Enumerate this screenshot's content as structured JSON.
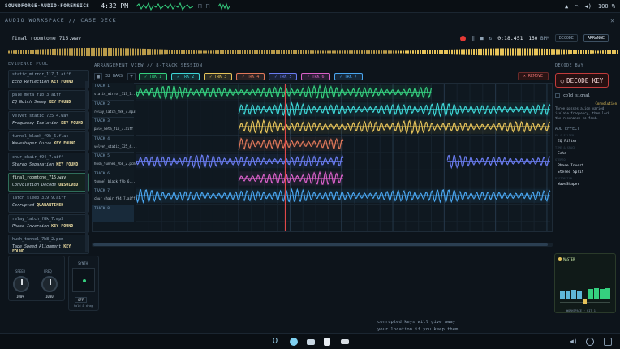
{
  "system": {
    "app_name": "SOUNDFORGE-AUDIO-FORENSICS",
    "clock": "4:32 PM",
    "battery": "100 %"
  },
  "window": {
    "title": "AUDIO WORKSPACE // CASE DECK",
    "close_label": "✕"
  },
  "file": {
    "name": "final_roomtone_715.wav"
  },
  "transport": {
    "time": "0:18.451",
    "bpm": "150",
    "bpm_unit": "BPM",
    "mode1": "DECODE",
    "mode2": "ARRANGE"
  },
  "evidence": {
    "title": "EVIDENCE POOL",
    "items": [
      {
        "name": "static_mirror_117_1.aiff",
        "status": "Echo Reflection",
        "key": "KEY FOUND"
      },
      {
        "name": "pale_meta_f1b_3.aiff",
        "status": "EQ Notch Sweep",
        "key": "KEY FOUND"
      },
      {
        "name": "velvet_static_725_4.wav",
        "status": "Frequency Isolation",
        "key": "KEY FOUND"
      },
      {
        "name": "tunnel_black_f9b_6.flac",
        "status": "Waveshaper Curve",
        "key": "KEY FOUND"
      },
      {
        "name": "chur_chair_f94_7.aiff",
        "status": "Stereo Separation",
        "key": "KEY FOUND"
      },
      {
        "name": "final_roomtone_715.wav",
        "status": "Convolution Decode",
        "key": "UNSOLVED"
      },
      {
        "name": "latch_sleep_319_9.aiff",
        "status": "Corrupted",
        "key": "QUARANTINED"
      },
      {
        "name": "relay_latch_f8k_7.mp3",
        "status": "Phase Inversion",
        "key": "KEY FOUND"
      },
      {
        "name": "hush_tunnel_7b8_2.pcm",
        "status": "Tape Speed Alignment",
        "key": "KEY FOUND"
      }
    ]
  },
  "arrangement": {
    "title": "ARRANGEMENT VIEW // 8-TRACK SESSION",
    "bars_label": "32 BARS",
    "remove_label": "✕ REMOVE",
    "tabs": [
      {
        "label": "✓ TRK 1",
        "color": "#35d07f"
      },
      {
        "label": "✓ TRK 2",
        "color": "#3ed6d6"
      },
      {
        "label": "✓ TRK 3",
        "color": "#e6c35a"
      },
      {
        "label": "✓ TRK 4",
        "color": "#e0785a"
      },
      {
        "label": "✓ TRK 5",
        "color": "#6a7cf0"
      },
      {
        "label": "✓ TRK 6",
        "color": "#d860c8"
      },
      {
        "label": "✓ TRK 7",
        "color": "#4aa6f0"
      }
    ],
    "tracks": [
      {
        "label": "TRACK 1",
        "file": "static_mirror_117_1...",
        "color": "#35d07f"
      },
      {
        "label": "TRACK 2",
        "file": "relay_latch_f8k_7.mp3",
        "color": "#3ed6d6"
      },
      {
        "label": "TRACK 3",
        "file": "pale_meta_f1b_3.aiff",
        "color": "#e6c35a"
      },
      {
        "label": "TRACK 4",
        "file": "velvet_static_725_4...",
        "color": "#e0785a"
      },
      {
        "label": "TRACK 5",
        "file": "hush_tunnel_7b8_2.pcm",
        "color": "#6a7cf0"
      },
      {
        "label": "TRACK 6",
        "file": "tunnel_black_f9b_6...",
        "color": "#d860c8"
      },
      {
        "label": "TRACK 7",
        "file": "chur_chair_f94_7.aiff",
        "color": "#4aa6f0"
      },
      {
        "label": "TRACK 8",
        "file": "",
        "color": "#4aa6f0"
      }
    ]
  },
  "decode": {
    "title": "DECODE BAY",
    "button_label": "DECODE KEY",
    "cold_label": "cold signal",
    "hint_tag": "Convolution",
    "hint_text": "Three passes align varied, isolate frequency, then lock the resonance to feed.",
    "add_effect": "ADD EFFECT",
    "groups": [
      {
        "group": "EQ & FILTER",
        "fx": "EQ Filter"
      },
      {
        "group": "TIME & SPACE",
        "fx": "Echo"
      },
      {
        "group": "STEREO",
        "fx": "Phase Invert"
      },
      {
        "group": "",
        "fx": "Stereo Split"
      },
      {
        "group": "DISTORTION",
        "fx": "WaveShaper"
      }
    ]
  },
  "knobs": {
    "speed_label": "SPEED",
    "speed_value": "100%",
    "freq_label": "FREQ",
    "freq_value": "1000"
  },
  "synth": {
    "title": "SYNTH",
    "state": "OFF",
    "sub": "hold & drag"
  },
  "master": {
    "title": "MASTER",
    "footer": "WORKSPACE · KIT 1"
  },
  "subtitle": {
    "line1": "corrupted keys will give away",
    "line2": "your location if you keep them"
  }
}
